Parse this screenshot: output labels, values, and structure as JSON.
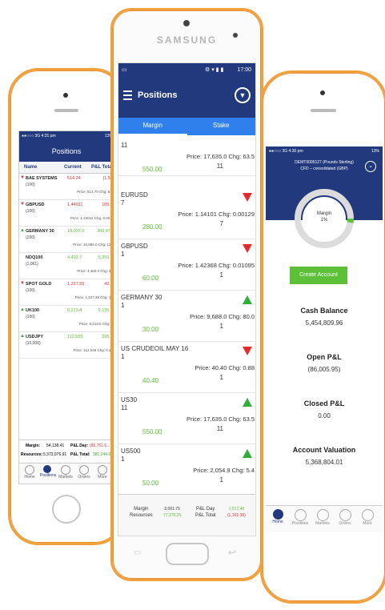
{
  "center": {
    "brand": "SAMSUNG",
    "status_time": "17:00",
    "title": "Positions",
    "tabs": [
      "Margin",
      "Stake"
    ],
    "rows": [
      {
        "name": "",
        "qty": "11",
        "value": "550.00",
        "price": "Price: 17,635.0 Chg: 63.5",
        "extra": "11",
        "dir": "none"
      },
      {
        "name": "EURUSD",
        "qty": "7",
        "value": "280.00",
        "price": "Price: 1.14101 Chg: 0.00129",
        "extra": "7",
        "dir": "down"
      },
      {
        "name": "GBPUSD",
        "qty": "1",
        "value": "60.00",
        "price": "Price: 1.42368 Chg: 0.01095",
        "extra": "1",
        "dir": "down"
      },
      {
        "name": "GERMANY 30",
        "qty": "1",
        "value": "30.00",
        "price": "Price: 9,688.0 Chg: 80.0",
        "extra": "1",
        "dir": "up"
      },
      {
        "name": "US CRUDEOIL MAY 16",
        "qty": "1",
        "value": "40.40",
        "price": "Price: 40.40 Chg: 0.88",
        "extra": "1",
        "dir": "down"
      },
      {
        "name": "US30",
        "qty": "11",
        "value": "550.00",
        "price": "Price: 17,635.0 Chg: 63.5",
        "extra": "11",
        "dir": "up"
      },
      {
        "name": "US500",
        "qty": "1",
        "value": "50.00",
        "price": "Price: 2,054.9 Chg: 5.4",
        "extra": "1",
        "dir": "up"
      }
    ],
    "footer": {
      "margin_label": "Margin",
      "resources_label": "Resources",
      "margin_value": "2,061.75",
      "resources_value": "77,375.25",
      "pl_day_label": "P&L Day",
      "pl_total_label": "P&L Total",
      "pl_day_value": "1,017.48",
      "pl_total_value": "(1,162.30)"
    }
  },
  "left": {
    "status": "●●○○○ 3G 4:31 pm",
    "battery": "13%",
    "title": "Positions",
    "cols": [
      "Name",
      "Current",
      "P&L Total"
    ],
    "rows": [
      {
        "name": "BAE SYSTEMS",
        "qty": "(100)",
        "current": "514.24",
        "pnl": "(1.52",
        "price": "Price: 513.70 Chg: 6.2",
        "dir": "down"
      },
      {
        "name": "GBPUSD",
        "qty": "(100)",
        "current": "1.44011",
        "pnl": "105.2",
        "price": "Price: 1.44011 Chg: 0.00...",
        "dir": "down"
      },
      {
        "name": "GERMANY 30",
        "qty": "(100)",
        "current": "10,037.0",
        "pnl": "300,477",
        "price": "Price: 10,056.0 Chg: 122",
        "dir": "up"
      },
      {
        "name": "NDQ100",
        "qty": "(1,061)",
        "current": "4,492.7",
        "pnl": "5,253.0",
        "price": "Price: 4,460.0 Chg: 29",
        "dir": "none"
      },
      {
        "name": "SPOT GOLD",
        "qty": "(100)",
        "current": "1,227.55",
        "pnl": "42.5",
        "price": "Price: 1,227.38 Chg: 10",
        "dir": "down"
      },
      {
        "name": "UK100",
        "qty": "(100)",
        "current": "6,213.4",
        "pnl": "9,135.0",
        "price": "Price: 6,213.5 Chg: 6",
        "dir": "up"
      },
      {
        "name": "USDJPY",
        "qty": "(10,000)",
        "current": "112.555",
        "pnl": "295.0",
        "price": "Price: 112.549 Chg: 0.19",
        "dir": "up"
      }
    ],
    "margin_label": "Margin:",
    "margin_value": "54,138.41",
    "pl_day_label": "P&L Day:",
    "pl_day_value": "(86,751.6...",
    "resources_label": "Resources:",
    "resources_value": "5,373,976.91",
    "pl_total_label": "P&L Total:",
    "pl_total_value": "381,244.0",
    "nav": [
      "Home",
      "Positions",
      "Markets",
      "Orders",
      "More"
    ]
  },
  "right": {
    "status": "●●○○○ 3G 4:30 pm",
    "battery": "13%",
    "account_line1": "DEMT0005127 (Pounds Sterling)",
    "account_line2": "CFD – consolidated (GBP)",
    "gauge_label": "Margin",
    "gauge_value": "1%",
    "create_button": "Create Account",
    "stats": [
      {
        "label": "Cash Balance",
        "value": "5,454,809.96"
      },
      {
        "label": "Open P&L",
        "value": "(86,005.95)"
      },
      {
        "label": "Closed P&L",
        "value": "0.00"
      },
      {
        "label": "Account Valuation",
        "value": "5,368,804.01"
      }
    ],
    "nav": [
      "Home",
      "Positions",
      "Markets",
      "Orders",
      "More"
    ]
  }
}
